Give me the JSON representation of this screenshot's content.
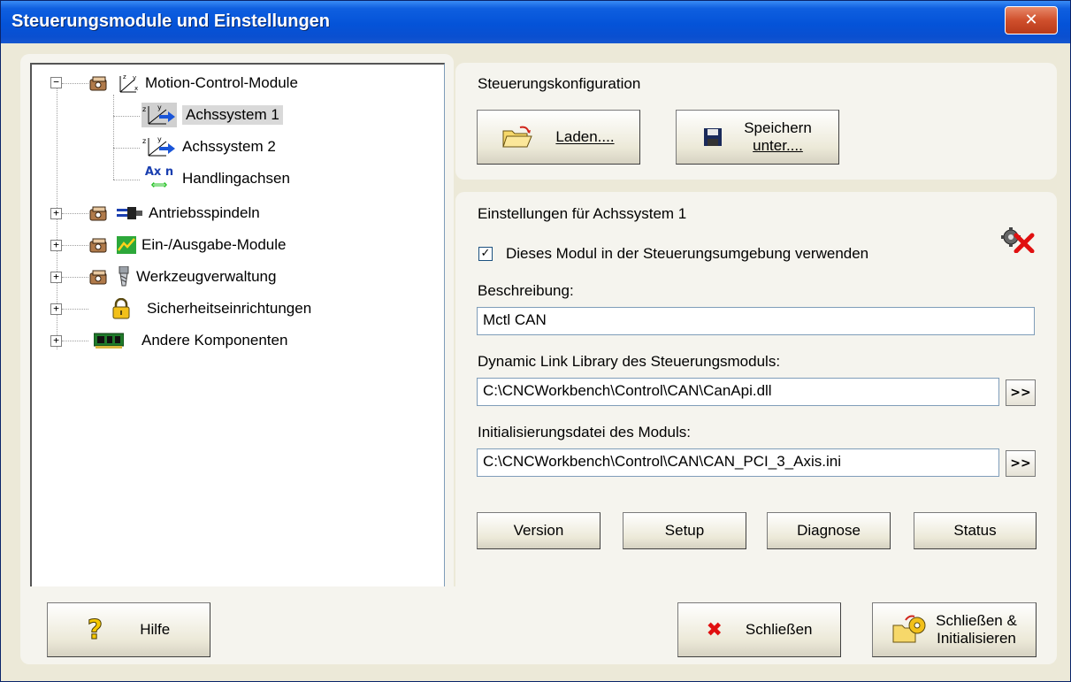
{
  "window": {
    "title": "Steuerungsmodule und Einstellungen",
    "close_glyph": "✕"
  },
  "tree": {
    "items": [
      {
        "label": "Motion-Control-Module",
        "icon": "axis-icon",
        "expander": "−"
      },
      {
        "label": "Achssystem 1",
        "icon": "axis-system-icon"
      },
      {
        "label": "Achssystem 2",
        "icon": "axis-system-icon"
      },
      {
        "label": "Handlingachsen",
        "icon": "handling-axis-icon",
        "icon_text": "Ax n"
      },
      {
        "label": "Antriebsspindeln",
        "icon": "spindle-icon",
        "expander": "+"
      },
      {
        "label": "Ein-/Ausgabe-Module",
        "icon": "io-module-icon",
        "expander": "+"
      },
      {
        "label": "Werkzeugverwaltung",
        "icon": "tool-icon",
        "expander": "+"
      },
      {
        "label": "Sicherheitseinrichtungen",
        "icon": "lock-icon",
        "expander": "+"
      },
      {
        "label": "Andere Komponenten",
        "icon": "component-icon",
        "expander": "+"
      }
    ]
  },
  "config": {
    "heading": "Steuerungskonfiguration",
    "load_label": "Laden....",
    "save_label_1": "Speichern",
    "save_label_2": "unter...."
  },
  "settings": {
    "heading": "Einstellungen für  Achssystem 1",
    "use_module_label": "Dieses Modul in der Steuerungsumgebung verwenden",
    "use_module_checked": "✓",
    "description_label": "Beschreibung:",
    "description_value": "Mctl CAN",
    "dll_label": "Dynamic Link Library des Steuerungsmoduls:",
    "dll_value": "C:\\CNCWorkbench\\Control\\CAN\\CanApi.dll",
    "ini_label": "Initialisierungsdatei des Moduls:",
    "ini_value": "C:\\CNCWorkbench\\Control\\CAN\\CAN_PCI_3_Axis.ini",
    "browse_label": ">>",
    "version_label": "Version",
    "setup_label": "Setup",
    "diagnose_label": "Diagnose",
    "status_label": "Status"
  },
  "footer": {
    "help_label": "Hilfe",
    "help_glyph": "?",
    "close_label": "Schließen",
    "close_glyph": "✖",
    "close_init_label_1": "Schließen &",
    "close_init_label_2": "Initialisieren"
  }
}
